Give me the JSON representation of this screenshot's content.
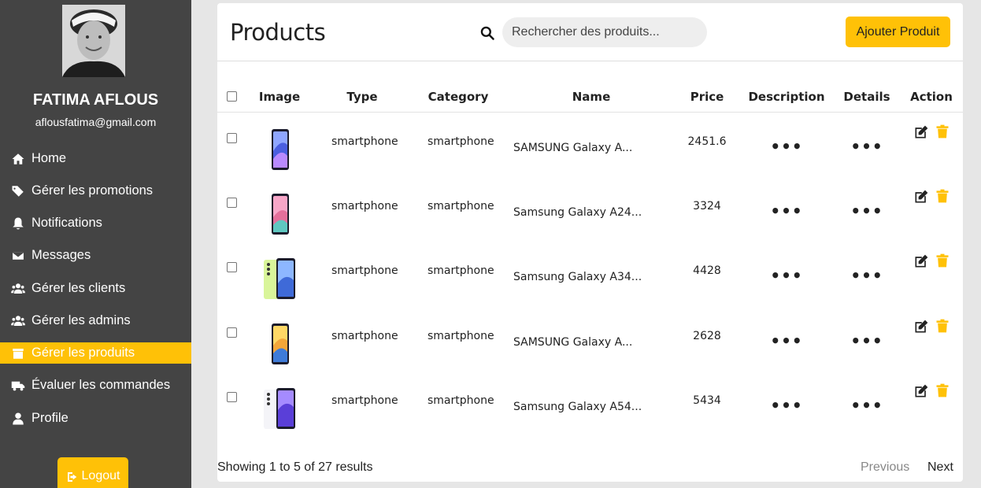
{
  "user": {
    "name": "FATIMA AFLOUS",
    "email": "aflousfatima@gmail.com"
  },
  "sidebar": {
    "items": [
      {
        "label": "Home",
        "icon": "home-icon"
      },
      {
        "label": "Gérer les promotions",
        "icon": "tags-icon"
      },
      {
        "label": "Notifications",
        "icon": "bell-icon"
      },
      {
        "label": "Messages",
        "icon": "envelope-icon"
      },
      {
        "label": "Gérer les clients",
        "icon": "users-icon"
      },
      {
        "label": "Gérer les admins",
        "icon": "users-icon"
      },
      {
        "label": "Gérer les produits",
        "icon": "box-icon",
        "active": true
      },
      {
        "label": "Évaluer les commandes",
        "icon": "truck-icon"
      },
      {
        "label": "Profile",
        "icon": "user-icon"
      }
    ],
    "logout_label": "Logout"
  },
  "header": {
    "title": "Products",
    "search_placeholder": "Rechercher des produits...",
    "add_button_label": "Ajouter Produit"
  },
  "table": {
    "columns": [
      "Image",
      "Type",
      "Category",
      "Name",
      "Price",
      "Description",
      "Details",
      "Action"
    ],
    "rows": [
      {
        "type": "smartphone",
        "category": "smartphone",
        "name": "SAMSUNG Galaxy A...",
        "price": "2451.6",
        "description": "•••",
        "details": "•••",
        "image": "phone-blue"
      },
      {
        "type": "smartphone",
        "category": "smartphone",
        "name": "Samsung Galaxy A24...",
        "price": "3324",
        "description": "•••",
        "details": "•••",
        "image": "phone-pink"
      },
      {
        "type": "smartphone",
        "category": "smartphone",
        "name": "Samsung Galaxy A34...",
        "price": "4428",
        "description": "•••",
        "details": "•••",
        "image": "phone-lime"
      },
      {
        "type": "smartphone",
        "category": "smartphone",
        "name": "SAMSUNG Galaxy A...",
        "price": "2628",
        "description": "•••",
        "details": "•••",
        "image": "phone-yellow"
      },
      {
        "type": "smartphone",
        "category": "smartphone",
        "name": "Samsung Galaxy A54...",
        "price": "5434",
        "description": "•••",
        "details": "•••",
        "image": "phone-violet"
      }
    ]
  },
  "footer": {
    "showing_text": "Showing 1 to 5 of 27 results",
    "previous_label": "Previous",
    "next_label": "Next"
  },
  "colors": {
    "sidebar_bg": "#444444",
    "accent": "#ffc107",
    "page_bg": "#e6e6e6"
  }
}
